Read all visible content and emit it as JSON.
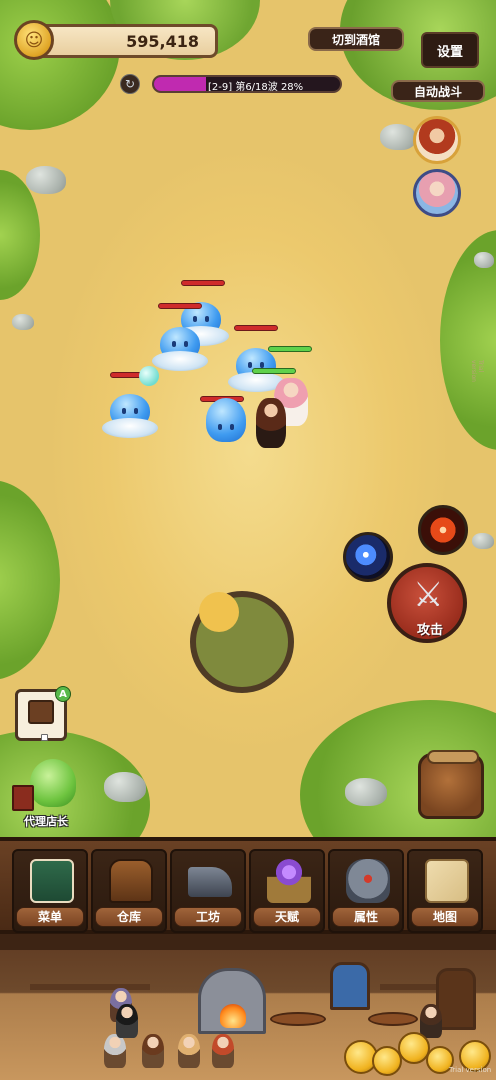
{
  "currency": {
    "gold": "595,418",
    "icon": "coin-icon"
  },
  "buttons": {
    "settings": "设置",
    "to_tavern": "切到酒馆",
    "auto_battle": "自动战斗",
    "attack": "攻击"
  },
  "wave": {
    "label": "[2-9]  第6/18波  28%",
    "progress": 0.28
  },
  "manager": {
    "label": "代理店长",
    "badge": "A"
  },
  "nav": {
    "items": [
      {
        "label": "菜单",
        "icon": "recipe-book-icon"
      },
      {
        "label": "仓库",
        "icon": "chest-icon"
      },
      {
        "label": "工坊",
        "icon": "anvil-icon"
      },
      {
        "label": "天赋",
        "icon": "talent-crystal-icon"
      },
      {
        "label": "属性",
        "icon": "armor-icon"
      },
      {
        "label": "地图",
        "icon": "map-icon"
      }
    ]
  },
  "watermark": "Trial version",
  "colors": {
    "wave_fill": "#c02ab0",
    "enemy_hp": "#cf2b2b",
    "ally_hp": "#5ed14b",
    "attack": "#9a2d1d"
  }
}
